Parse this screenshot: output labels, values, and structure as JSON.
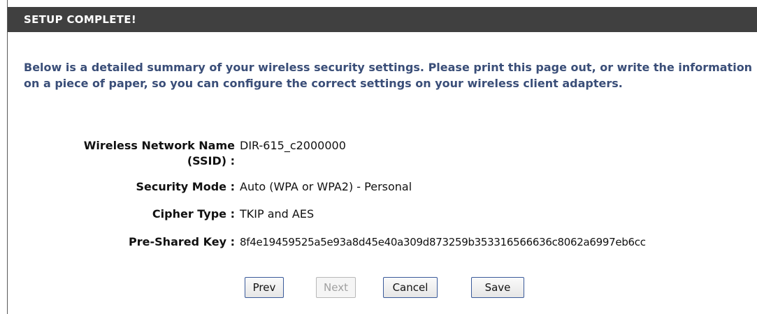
{
  "header": {
    "title": "SETUP COMPLETE!"
  },
  "intro": {
    "text": "Below is a detailed summary of your wireless security settings. Please print this page out, or write the information on a piece of paper, so you can configure the correct settings on your wireless client adapters."
  },
  "settings": {
    "ssid_label_line1": "Wireless Network Name",
    "ssid_label_line2": "(SSID) :",
    "ssid_value": "DIR-615_c2000000",
    "security_mode_label": "Security Mode :",
    "security_mode_value": "Auto (WPA or WPA2) - Personal",
    "cipher_type_label": "Cipher Type :",
    "cipher_type_value": "TKIP and AES",
    "psk_label": "Pre-Shared Key :",
    "psk_value": "8f4e19459525a5e93a8d45e40a309d873259b353316566636c8062a6997eb6cc"
  },
  "buttons": {
    "prev": "Prev",
    "next": "Next",
    "cancel": "Cancel",
    "save": "Save"
  },
  "colors": {
    "header_bg": "#404040",
    "intro_text": "#3a4e78",
    "button_border": "#3a5a9a"
  }
}
